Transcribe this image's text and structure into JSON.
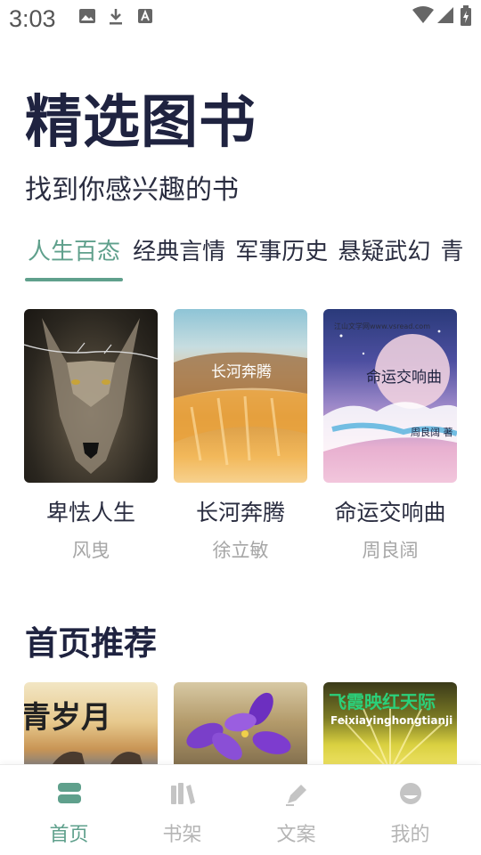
{
  "status_bar": {
    "time": "3:03"
  },
  "header": {
    "title": "精选图书",
    "subtitle": "找到你感兴趣的书"
  },
  "tabs": [
    {
      "label": "人生百态",
      "active": true
    },
    {
      "label": "经典言情",
      "active": false
    },
    {
      "label": "军事历史",
      "active": false
    },
    {
      "label": "悬疑武幻",
      "active": false
    },
    {
      "label": "青",
      "active": false
    }
  ],
  "featured_books": [
    {
      "title": "卑怯人生",
      "author": "风曳",
      "cover_text": ""
    },
    {
      "title": "长河奔腾",
      "author": "徐立敏",
      "cover_text": "长河奔腾"
    },
    {
      "title": "命运交响曲",
      "author": "周良阔",
      "cover_text": "命运交响曲",
      "cover_site": "江山文学网www.vsread.com",
      "cover_author": "周良阔 著"
    }
  ],
  "recommend": {
    "title": "首页推荐",
    "books": [
      {
        "cover_text": "青岁月"
      },
      {
        "cover_text": ""
      },
      {
        "cover_text": "飞霞映红天际",
        "cover_subtext": "Feixiayinghongtianji"
      }
    ]
  },
  "bottom_nav": [
    {
      "label": "首页",
      "icon": "home-icon",
      "active": true
    },
    {
      "label": "书架",
      "icon": "bookshelf-icon",
      "active": false
    },
    {
      "label": "文案",
      "icon": "pen-icon",
      "active": false
    },
    {
      "label": "我的",
      "icon": "profile-icon",
      "active": false
    }
  ],
  "colors": {
    "accent": "#5fa08c",
    "title": "#1f2340",
    "muted": "#a6a6a6"
  }
}
